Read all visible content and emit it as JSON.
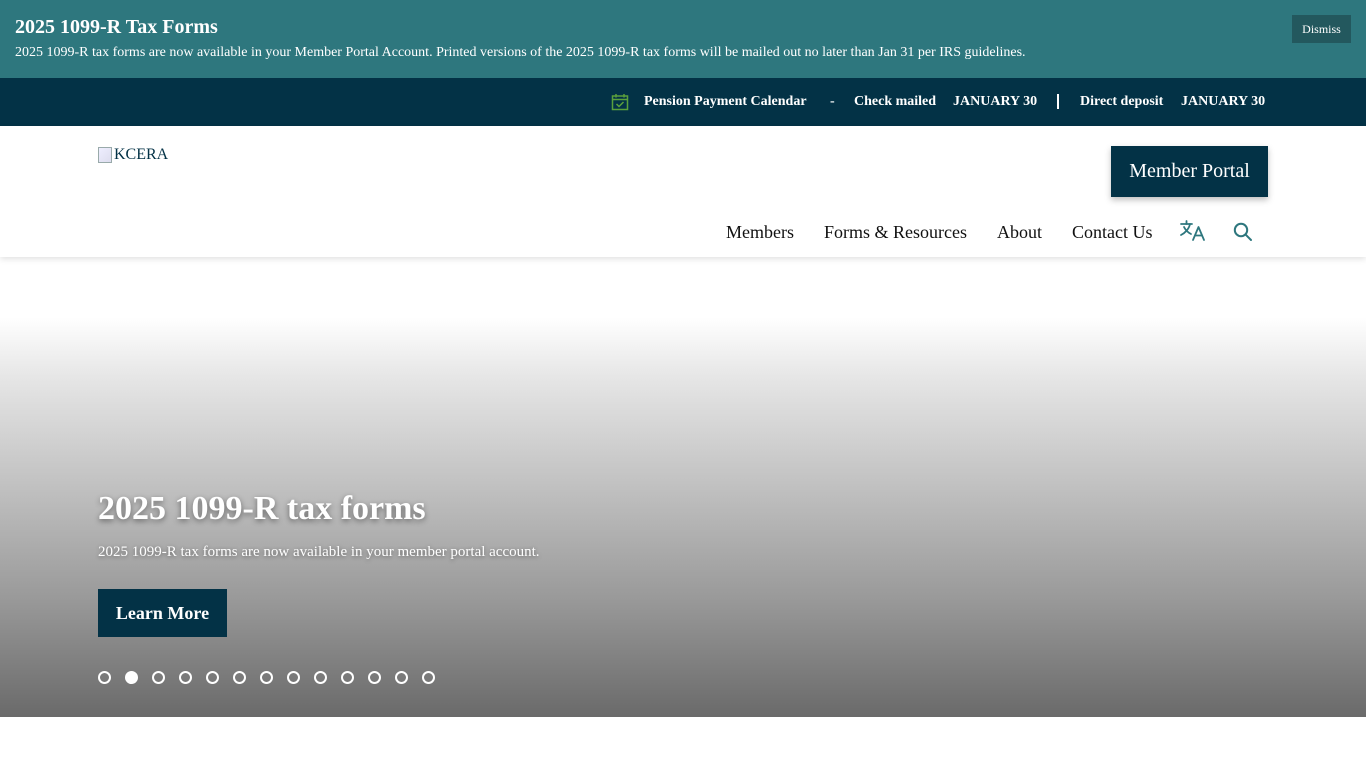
{
  "alert": {
    "title": "2025 1099-R Tax Forms",
    "text": "2025 1099-R tax forms are now available in your Member Portal Account. Printed versions of the 2025 1099-R tax forms will be mailed out no later than Jan 31 per IRS guidelines.",
    "dismiss_label": "Dismiss"
  },
  "pension": {
    "icon": "calendar-check-icon",
    "label": "Pension Payment Calendar",
    "separator": "-",
    "check_label": "Check mailed",
    "check_date": "JANUARY 30",
    "deposit_label": "Direct deposit",
    "deposit_date": "JANUARY 30"
  },
  "header": {
    "logo_alt": "KCERA",
    "member_portal_label": "Member Portal",
    "nav": [
      {
        "label": "Members"
      },
      {
        "label": "Forms & Resources"
      },
      {
        "label": "About"
      },
      {
        "label": "Contact Us"
      }
    ],
    "translate_icon": "translate-icon",
    "search_icon": "search-icon"
  },
  "hero": {
    "title": "2025 1099-R tax forms",
    "text": "2025 1099-R tax forms are now available in your member portal account.",
    "button_label": "Learn More",
    "slide_count": 13,
    "active_slide": 2
  },
  "colors": {
    "alert_bg": "#2e777e",
    "dark_navy": "#033246",
    "accent_green": "#5aa03c",
    "icon_teal": "#2e777e"
  }
}
